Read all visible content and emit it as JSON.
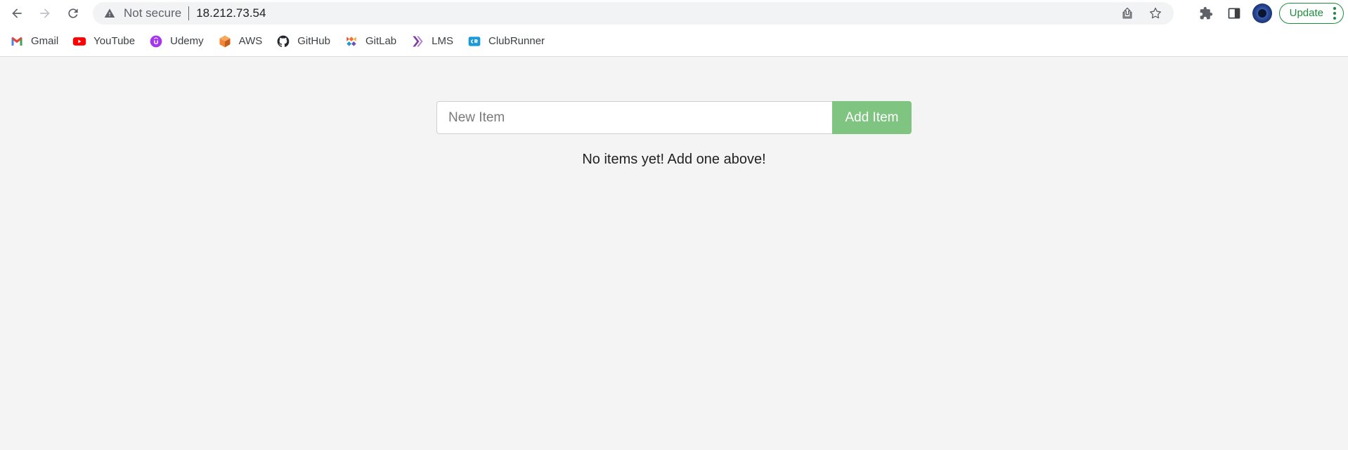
{
  "toolbar": {
    "security_label": "Not secure",
    "url": "18.212.73.54",
    "update_label": "Update"
  },
  "bookmarks": [
    {
      "label": "Gmail",
      "icon": "gmail-icon",
      "color": "#ea4335"
    },
    {
      "label": "YouTube",
      "icon": "youtube-icon",
      "color": "#ff0000"
    },
    {
      "label": "Udemy",
      "icon": "udemy-icon",
      "color": "#a435f0"
    },
    {
      "label": "AWS",
      "icon": "aws-icon",
      "color": "#f58536"
    },
    {
      "label": "GitHub",
      "icon": "github-icon",
      "color": "#24292f"
    },
    {
      "label": "GitLab",
      "icon": "gitlab-icon",
      "color": "#fc6d26"
    },
    {
      "label": "LMS",
      "icon": "lms-icon",
      "color": "#7b3fa0"
    },
    {
      "label": "ClubRunner",
      "icon": "clubrunner-icon",
      "color": "#1c9ad6"
    }
  ],
  "main": {
    "input_placeholder": "New Item",
    "input_value": "",
    "add_button_label": "Add Item",
    "empty_message": "No items yet! Add one above!"
  },
  "colors": {
    "page_background": "#f4f4f4",
    "add_button": "#7fc481",
    "update_accent": "#1e8e3e"
  }
}
